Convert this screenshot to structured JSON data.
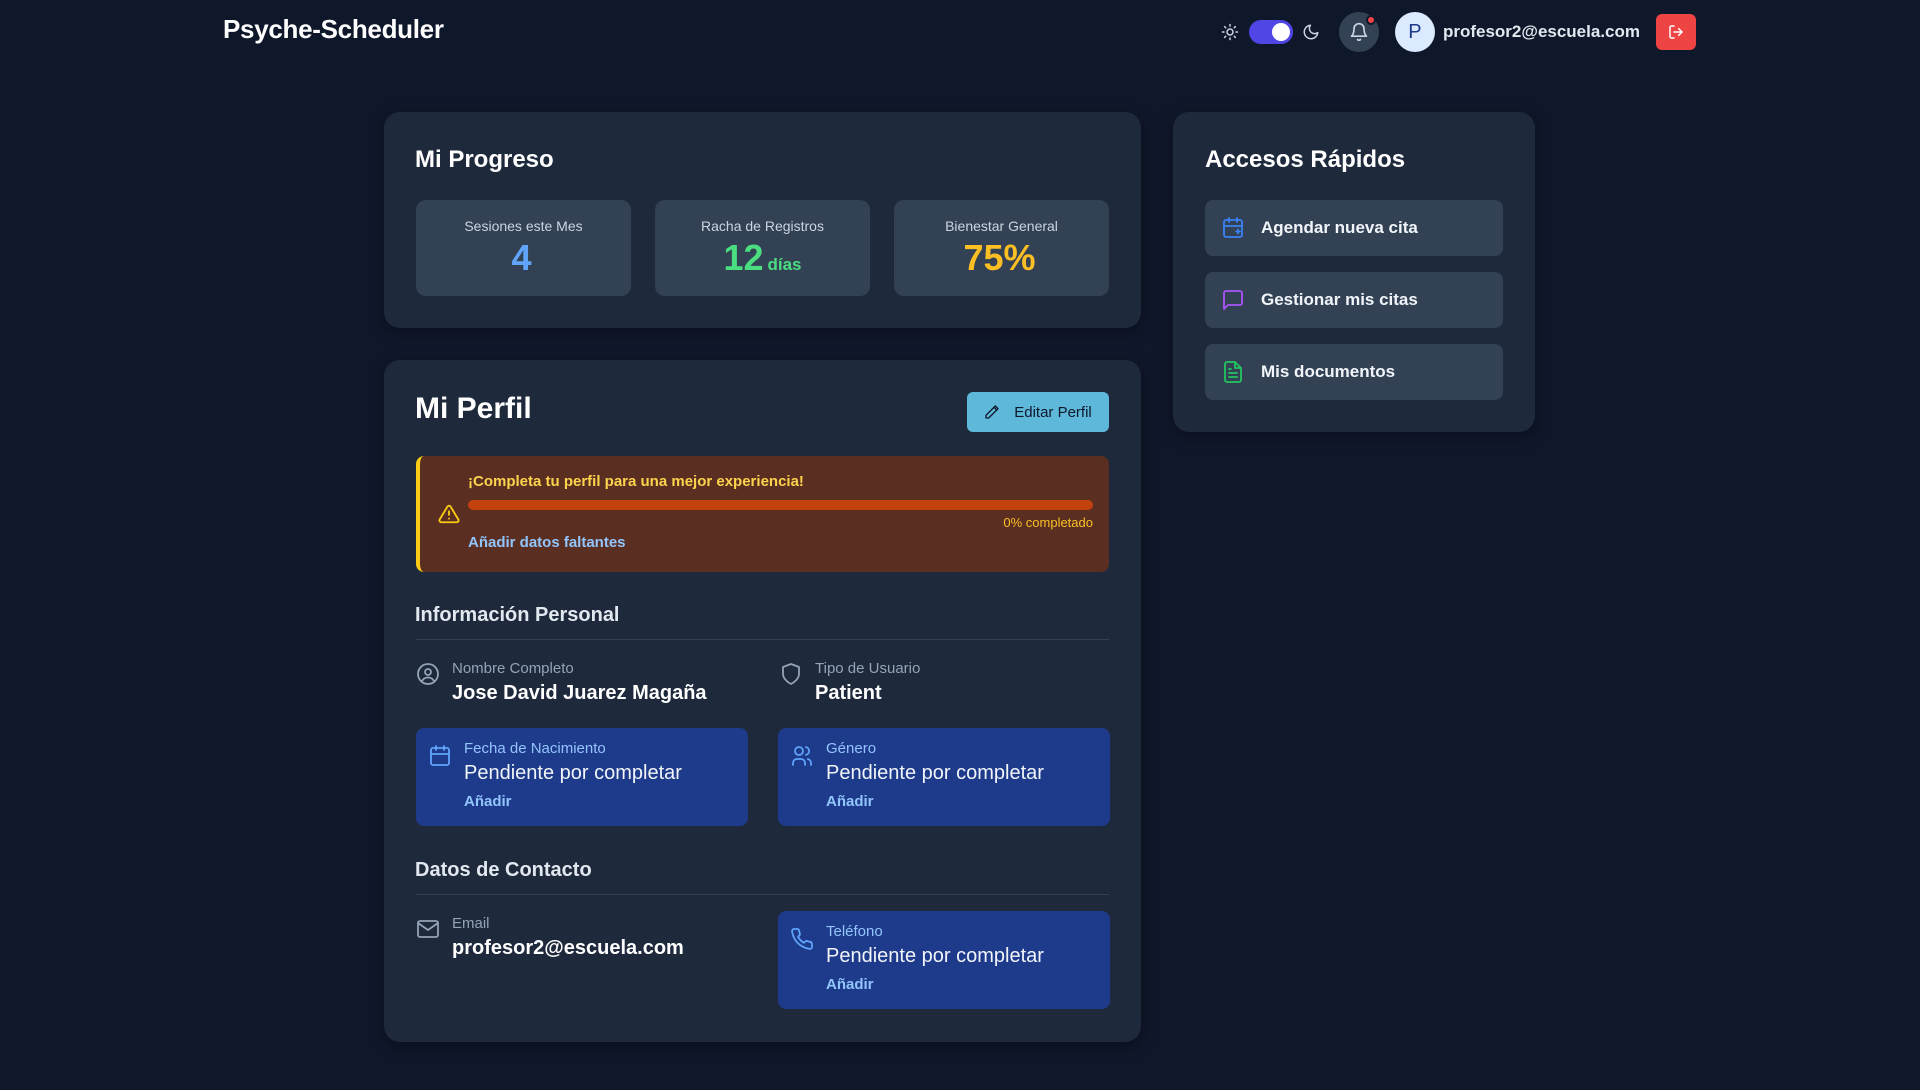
{
  "header": {
    "brand": "Psyche-Scheduler",
    "theme_icons": [
      "sun-icon",
      "moon-icon"
    ],
    "dark_mode": true,
    "notification_icon": "bell-icon",
    "avatar_initial": "P",
    "user_email": "profesor2@escuela.com",
    "logout_icon": "logout-icon"
  },
  "progress": {
    "title": "Mi Progreso",
    "stats": [
      {
        "label": "Sesiones este Mes",
        "value": "4",
        "unit": "",
        "color": "#60a5fa"
      },
      {
        "label": "Racha de Registros",
        "value": "12",
        "unit": "días",
        "color": "#4ade80"
      },
      {
        "label": "Bienestar General",
        "value": "75%",
        "unit": "",
        "color": "#fbbf24"
      }
    ]
  },
  "quick_access": {
    "title": "Accesos Rápidos",
    "items": [
      {
        "label": "Agendar nueva cita",
        "icon": "calendar-plus-icon",
        "color": "#3b82f6"
      },
      {
        "label": "Gestionar mis citas",
        "icon": "message-icon",
        "color": "#a855f7"
      },
      {
        "label": "Mis documentos",
        "icon": "document-icon",
        "color": "#22c55e"
      }
    ]
  },
  "profile": {
    "title": "Mi Perfil",
    "edit_label": "Editar Perfil",
    "alert": {
      "title": "¡Completa tu perfil para una mejor experiencia!",
      "progress": 0,
      "percent_label": "0% completado",
      "link": "Añadir datos faltantes"
    },
    "personal_section": "Información Personal",
    "full_name": {
      "label": "Nombre Completo",
      "value": "Jose David Juarez Magaña"
    },
    "user_type": {
      "label": "Tipo de Usuario",
      "value": "Patient"
    },
    "birth_date": {
      "label": "Fecha de Nacimiento",
      "value": "Pendiente por completar",
      "link": "Añadir"
    },
    "gender": {
      "label": "Género",
      "value": "Pendiente por completar",
      "link": "Añadir"
    },
    "contact_section": "Datos de Contacto",
    "email": {
      "label": "Email",
      "value": "profesor2@escuela.com"
    },
    "phone": {
      "label": "Teléfono",
      "value": "Pendiente por completar",
      "link": "Añadir"
    }
  }
}
